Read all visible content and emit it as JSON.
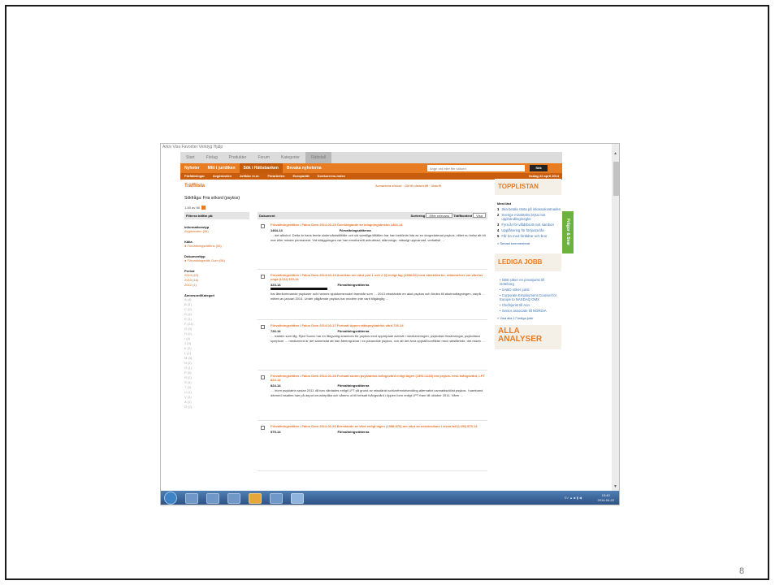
{
  "slide": {
    "page_number": "8"
  },
  "browser_menu": "Arkiv  Visa  Favoriter  Verktyg  Hjälp",
  "nav_top": {
    "items": [
      "Start",
      "Förlag",
      "Produkter",
      "Forum",
      "Kategorier",
      "Rättsfall"
    ],
    "active": 5
  },
  "nav_orange": {
    "items": [
      "Nyheter",
      "Mitt i juridiken",
      "Sök i Rättsbanken",
      "Bevaka nyheterna"
    ],
    "active": 2,
    "search_placeholder": "Ange ord eller fler sökord",
    "search_button": "Sök"
  },
  "nav_sub": {
    "items": [
      "Författningar",
      "Avgöranden",
      "Artiklar m.m.",
      "Förarbeten",
      "Europarätt",
      "Konkurrens-index"
    ],
    "date": "tisdag 22 april 2014"
  },
  "traffista": {
    "title": "Träfflista",
    "links": "Avmarkera sökord · Gå till nästa träff · Utskrift",
    "sokfraga": "Sökfråga: Fria sökord (psykos)",
    "antal": "1-50 av 56",
    "sidebar": {
      "header": "Filtrera träffar på:",
      "groups": [
        {
          "title": "Informationstyp",
          "values": [
            "Avgöranden (56)"
          ]
        },
        {
          "title": "Källa",
          "values": [
            "● Förvaltningsrättens (56)"
          ]
        },
        {
          "title": "Dokumenttyp",
          "values": [
            "● Förvaltningsrätt, Dom (56)"
          ]
        },
        {
          "title": "Period",
          "values": [
            "2014 (40)",
            "2013 (16)",
            "2012 (1)"
          ]
        }
      ],
      "kategori_title": "Ämnesord/Kategori",
      "kategorier": [
        "A (4)",
        "B (3)",
        "C (2)",
        "D (4)",
        "E (1)",
        "F (24)",
        "G (3)",
        "H (2)",
        "I (4)",
        "J (3)",
        "K (2)",
        "L (1)",
        "M (3)",
        "N (2)",
        "O (1)",
        "P (3)",
        "R (2)",
        "S (4)",
        "T (2)",
        "U (1)",
        "V (3)",
        "Ä (1)",
        "Ö (2)"
      ]
    },
    "results_header": {
      "dokument": "Dokument",
      "sortering_label": "Sortering",
      "sortering_value": "Efter relevans",
      "traffkontext_label": "Träffkontext",
      "traffkontext_value": "Visa"
    },
    "results": [
      {
        "title": "Förvaltningsrätten i Falun Dom 2014-03-25 Överklagande av inlagningsbeslut 1464-14",
        "nr": "1464-14",
        "court": "Förvaltningsrätterna",
        "snippet": "… det alkohol. Detta är hans femte slutenvårdstillfälle och vid samtliga tillfällen har han bedömts lida av en drogrelaterad psykos, vilket nu fortar att bli mer eller mindre permanent. Vid inläggningen var han emotionellt avtrubbad, stämnings- mässigt uppvarvad, verbalisk …"
      },
      {
        "title": "Förvaltningsrätten i Falun Dom 2014-03-13 Ansökan om vård just 1 och 2 §§ enligt lag (1988:52) med särskilda be- stämmelser om vård av unga (LVU) 323-14",
        "nr": "323-14",
        "court": "Förvaltningsrätterna",
        "snippet": "har återkommande psykoser och hennes sjukdomsmodel framstår som … 2013 misstänkte en akut psykos och fördes till akutmottagningen, varpå … mitten av januari 2014. Under pågående psykos har modern inte varit tillgänglig …"
      },
      {
        "title": "Förvaltningsrätten i Falun Dom 2014-03-17 Fortsatt öppen rättspsykiatrisk vård 726-14",
        "nr": "726-14",
        "court": "Förvaltningsrätterna",
        "snippet": "… trakten som låg. Rjed Sunnc har en långvarig anamnes för psykos med upprepade avbrott i medicineringen, psykotisk försämringar, psykotiska symptom … medicinera är det samröstat att han återinsjuknar i en paranoide psykos, och att det ärva uppstå konflikter med närstående, det risken …"
      },
      {
        "title": "Förvaltningsrätten i Falun Dom 2014-02-28 Fortsatt sluten psykiatrisk tvångsvård enligt lagen (1991:1128) om psykia- trisk tvångsvård, LPT 824-14",
        "nr": "824-14",
        "court": "Förvaltningsrätterna",
        "snippet": "… inom psykiatrin sedan 2011 då han vårdades enligt LPT på grund av misstänkt schizofreniutveckling alternativt cannabisutlöst psykos. I samband därmed insattes han på depot neuroleptika och sårens ut till fortsatt tvångsvård i öppen form enligt LPT fram till oktober 2011. Vårer …"
      },
      {
        "title": "Förvaltningsrätten i Falun Dom 2014-02-26 Beredande av vård enligt lagen (1988:870) om vård av missbrukare i vissa fall (LVM) 575-14",
        "nr": "575-14",
        "court": "Förvaltningsrätterna",
        "snippet": ""
      }
    ]
  },
  "right": {
    "topplistan": "TOPPLISTAN",
    "mest_last": "Mest läst",
    "items": [
      {
        "n": "1",
        "text": "Ska betala ränta på inkassokostnaden"
      },
      {
        "n": "2",
        "text": "Sverige misstänks bryta mot upphandlingsregler"
      },
      {
        "n": "3",
        "text": "Fyra år för våldsbrott mot sambon"
      },
      {
        "n": "4",
        "text": "Upplåsering för förtjusta lån"
      },
      {
        "n": "5",
        "text": "Får bo med föräldrar och bror"
      }
    ],
    "senast": "» Senast kommenterat",
    "lediga": "LEDIGA JOBB",
    "jobs": [
      "SEB söker en privatjurist till Göteborg",
      "SABO söker jurist",
      "Corporate Employment Counsel for Europe to NASDAQ OMX",
      "Chefsjurist till Aon",
      "Senior associate till NORDIA"
    ],
    "visa_alla": "» Visa alla 17 lediga jobb",
    "alla_analyser": "ALLA ANALYSER"
  },
  "feedback_tab": "Frågor & Svar",
  "taskbar": {
    "lang": "SV",
    "time": "13:40",
    "date": "2014-04-22"
  }
}
